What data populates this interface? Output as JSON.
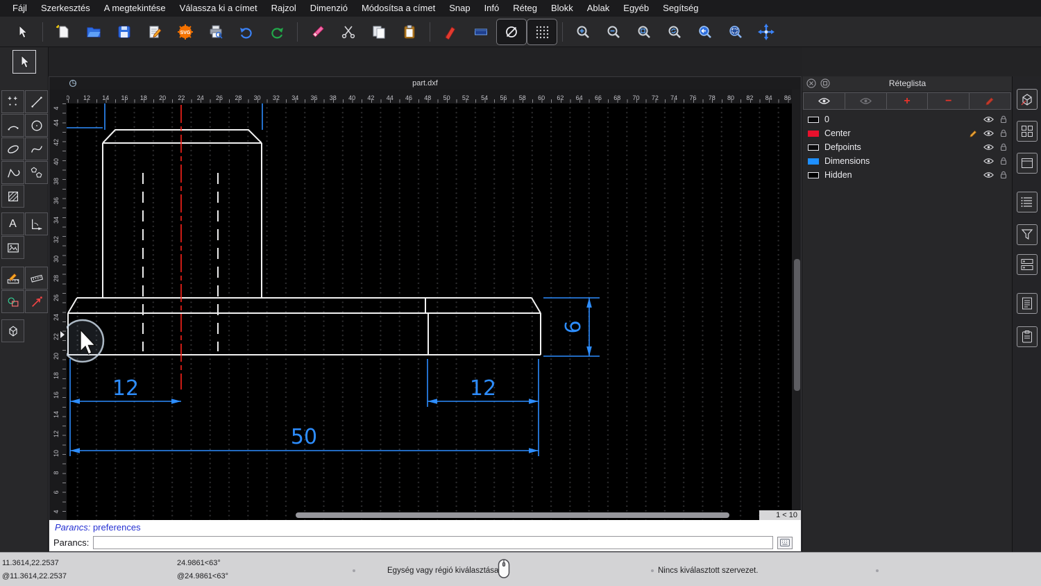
{
  "menubar": {
    "items": [
      "Fájl",
      "Szerkesztés",
      "A megtekintése",
      "Válassza ki a címet",
      "Rajzol",
      "Dimenzió",
      "Módosítsa a címet",
      "Snap",
      "Infó",
      "Réteg",
      "Blokk",
      "Ablak",
      "Egyéb",
      "Segítség"
    ]
  },
  "toolbar": {
    "svg_label": "SVG"
  },
  "left_toolbar": {
    "text_tool_label": "A"
  },
  "window": {
    "title": "part.dxf",
    "zoom_indicator": "1 < 10"
  },
  "rulers": {
    "top": [
      "0",
      "12",
      "14",
      "16",
      "18",
      "20",
      "22",
      "24",
      "26",
      "28",
      "30",
      "32",
      "34",
      "36",
      "38",
      "40",
      "42",
      "44",
      "46",
      "48",
      "50",
      "52",
      "54",
      "56",
      "58",
      "60",
      "62",
      "64",
      "66",
      "68",
      "70",
      "72",
      "74",
      "76",
      "78",
      "80",
      "82",
      "84",
      "86"
    ],
    "left_top": "4",
    "left": [
      "44",
      "42",
      "40",
      "38",
      "36",
      "34",
      "32",
      "30",
      "28",
      "26",
      "24",
      "22",
      "20",
      "18",
      "16",
      "14",
      "12",
      "10",
      "8",
      "6",
      "4"
    ]
  },
  "drawing": {
    "dim_left": "12",
    "dim_right": "12",
    "dim_total": "50",
    "dim_height": "6",
    "colors": {
      "outline": "#f2f2f2",
      "hidden": "#ececec",
      "center": "#ff241c",
      "dimension": "#2d8dff"
    }
  },
  "layers_panel": {
    "title": "Réteglista",
    "layers": [
      {
        "name": "0",
        "color": "#0a0a0c",
        "border": "#e9e9ee",
        "has_pencil": false
      },
      {
        "name": "Center",
        "color": "#e8112d",
        "border": "#e8112d",
        "has_pencil": true
      },
      {
        "name": "Defpoints",
        "color": "#0a0a0c",
        "border": "#e9e9ee",
        "has_pencil": false
      },
      {
        "name": "Dimensions",
        "color": "#1e8fff",
        "border": "#1e8fff",
        "has_pencil": false
      },
      {
        "name": "Hidden",
        "color": "#000000",
        "border": "#e9e9ee",
        "has_pencil": false
      }
    ],
    "add_label": "+",
    "remove_label": "−"
  },
  "command": {
    "history_label": "Parancs:",
    "history_value": "preferences",
    "prompt_label": "Parancs:",
    "input_value": ""
  },
  "statusbar": {
    "coords_abs": "11.3614,22.2537",
    "coords_rel": "@11.3614,22.2537",
    "polar_abs": "24.9861<63°",
    "polar_rel": "@24.9861<63°",
    "hint": "Egység vagy régió kiválasztása",
    "selection": "Nincs kiválasztott szervezet."
  }
}
